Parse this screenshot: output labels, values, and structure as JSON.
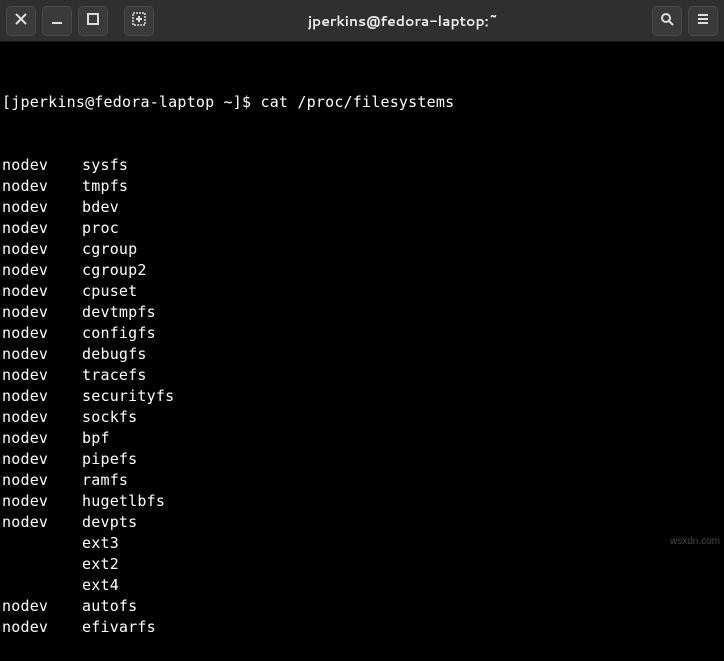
{
  "titlebar": {
    "title": "jperkins@fedora-laptop:~",
    "close_label": "close",
    "minimize_label": "minimize",
    "maximize_label": "maximize",
    "newtab_label": "new-tab",
    "search_label": "search",
    "menu_label": "menu"
  },
  "prompt": {
    "prefix": "[jperkins@fedora-laptop ~]$ ",
    "command": "cat /proc/filesystems"
  },
  "filesystems": [
    {
      "flag": "nodev",
      "name": "sysfs"
    },
    {
      "flag": "nodev",
      "name": "tmpfs"
    },
    {
      "flag": "nodev",
      "name": "bdev"
    },
    {
      "flag": "nodev",
      "name": "proc"
    },
    {
      "flag": "nodev",
      "name": "cgroup"
    },
    {
      "flag": "nodev",
      "name": "cgroup2"
    },
    {
      "flag": "nodev",
      "name": "cpuset"
    },
    {
      "flag": "nodev",
      "name": "devtmpfs"
    },
    {
      "flag": "nodev",
      "name": "configfs"
    },
    {
      "flag": "nodev",
      "name": "debugfs"
    },
    {
      "flag": "nodev",
      "name": "tracefs"
    },
    {
      "flag": "nodev",
      "name": "securityfs"
    },
    {
      "flag": "nodev",
      "name": "sockfs"
    },
    {
      "flag": "nodev",
      "name": "bpf"
    },
    {
      "flag": "nodev",
      "name": "pipefs"
    },
    {
      "flag": "nodev",
      "name": "ramfs"
    },
    {
      "flag": "nodev",
      "name": "hugetlbfs"
    },
    {
      "flag": "nodev",
      "name": "devpts"
    },
    {
      "flag": "",
      "name": "ext3"
    },
    {
      "flag": "",
      "name": "ext2"
    },
    {
      "flag": "",
      "name": "ext4"
    },
    {
      "flag": "nodev",
      "name": "autofs"
    },
    {
      "flag": "nodev",
      "name": "efivarfs"
    }
  ],
  "watermark": "wsxdn.com"
}
